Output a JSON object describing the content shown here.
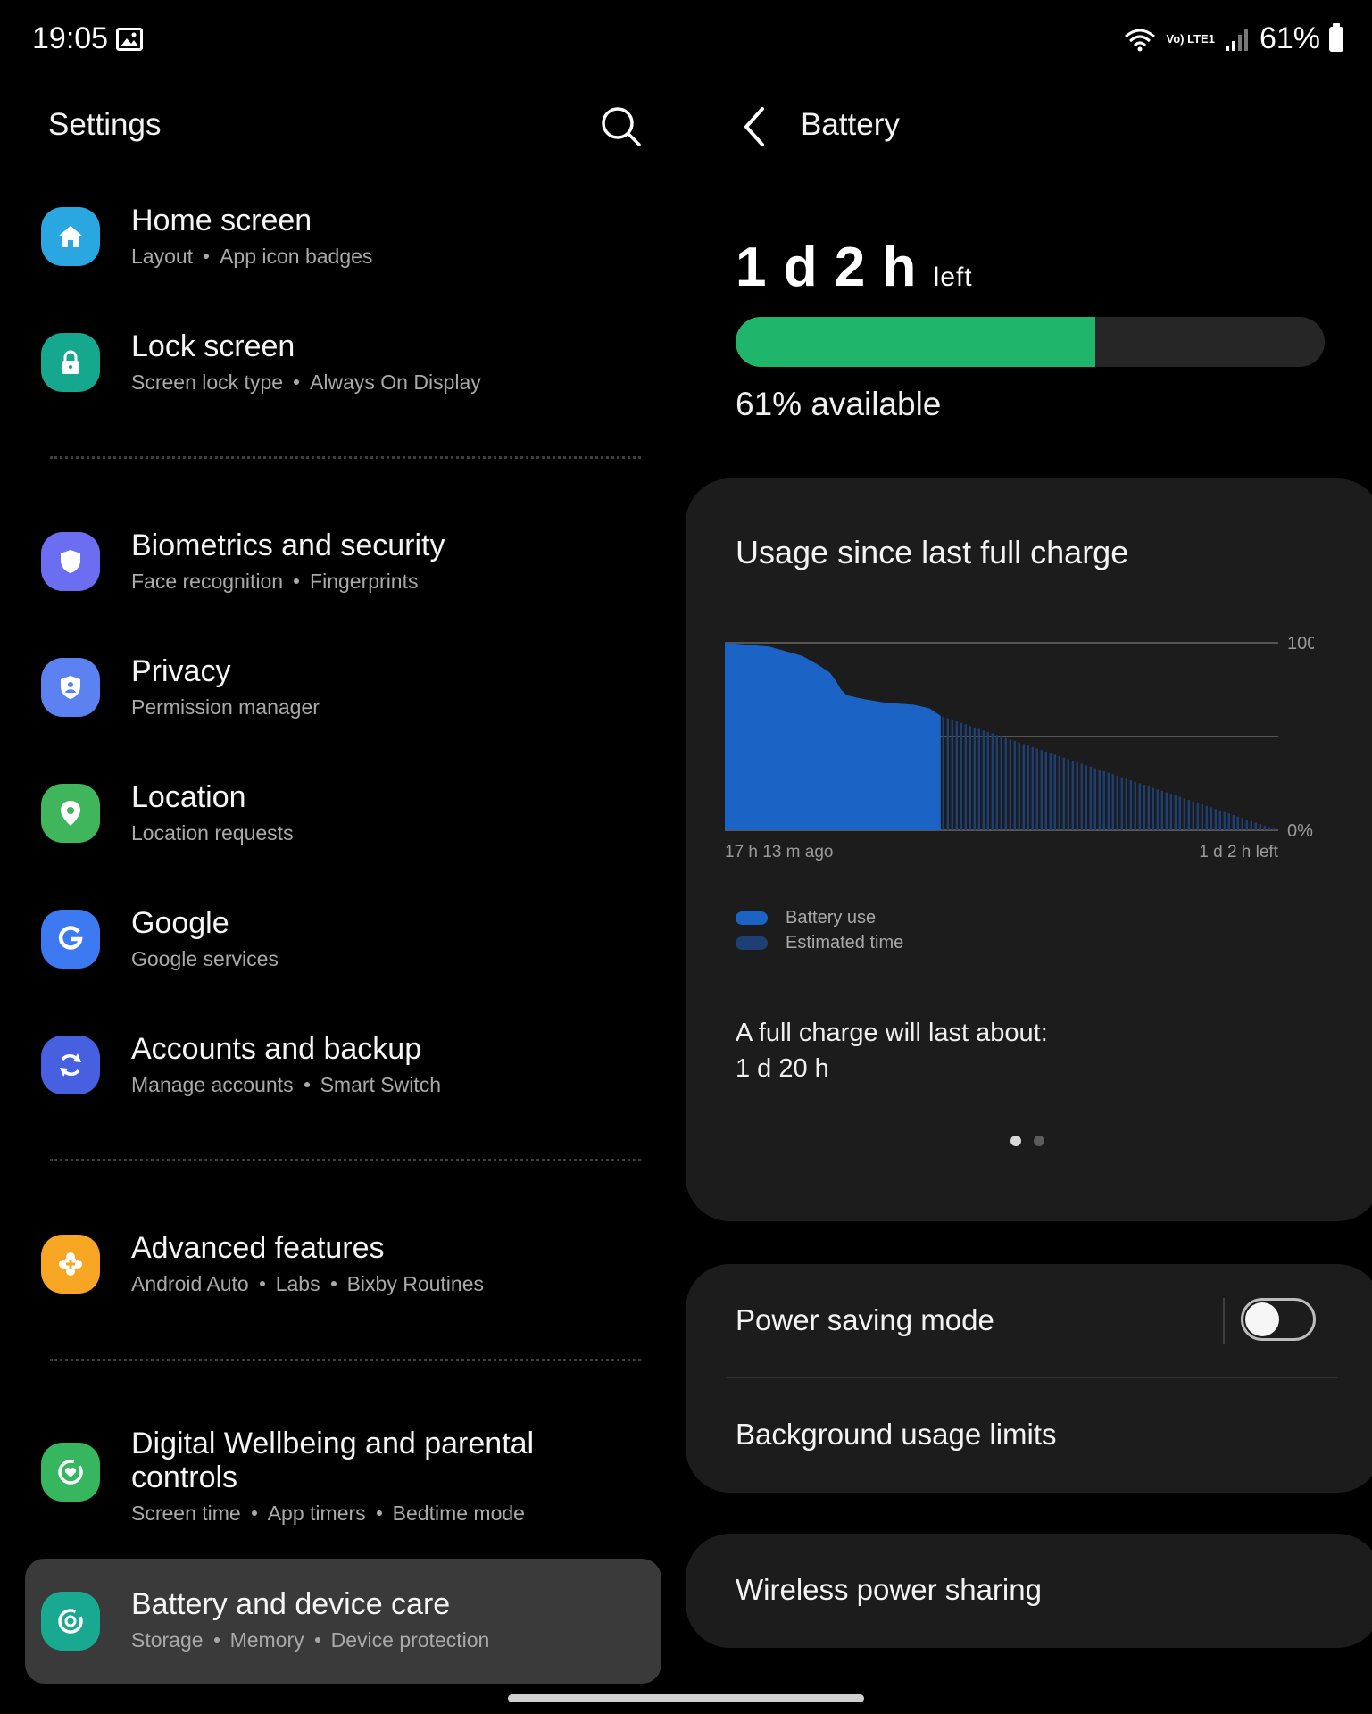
{
  "status_bar": {
    "time": "19:05",
    "network": "Vo) LTE1",
    "battery_percent": "61%",
    "icons": [
      "gallery-icon",
      "wifi-icon",
      "signal-icon",
      "battery-icon"
    ]
  },
  "settings": {
    "title": "Settings",
    "items": [
      {
        "title": "Home screen",
        "subtitle": [
          "Layout",
          "App icon badges"
        ],
        "icon": "home-icon",
        "color": "#2aa7e0"
      },
      {
        "title": "Lock screen",
        "subtitle": [
          "Screen lock type",
          "Always On Display"
        ],
        "icon": "lock-icon",
        "color": "#15a88e"
      },
      {
        "title": "Biometrics and security",
        "subtitle": [
          "Face recognition",
          "Fingerprints"
        ],
        "icon": "shield-icon",
        "color": "#6b6ef0"
      },
      {
        "title": "Privacy",
        "subtitle": [
          "Permission manager"
        ],
        "icon": "privacy-shield-icon",
        "color": "#5b82f0"
      },
      {
        "title": "Location",
        "subtitle": [
          "Location requests"
        ],
        "icon": "location-pin-icon",
        "color": "#3fb65b"
      },
      {
        "title": "Google",
        "subtitle": [
          "Google services"
        ],
        "icon": "google-g-icon",
        "color": "#3d79f0"
      },
      {
        "title": "Accounts and backup",
        "subtitle": [
          "Manage accounts",
          "Smart Switch"
        ],
        "icon": "sync-icon",
        "color": "#4660e0"
      },
      {
        "title": "Advanced features",
        "subtitle": [
          "Android Auto",
          "Labs",
          "Bixby Routines"
        ],
        "icon": "puzzle-icon",
        "color": "#f6a623"
      },
      {
        "title_line1": "Digital Wellbeing and parental",
        "title_line2": "controls",
        "subtitle": [
          "Screen time",
          "App timers",
          "Bedtime mode"
        ],
        "icon": "wellbeing-icon",
        "color": "#37b660"
      },
      {
        "title": "Battery and device care",
        "subtitle": [
          "Storage",
          "Memory",
          "Device protection"
        ],
        "icon": "device-care-icon",
        "color": "#19a991",
        "selected": true
      }
    ]
  },
  "battery": {
    "title": "Battery",
    "time_left": "1 d 2 h",
    "time_left_suffix": "left",
    "level_fraction": 0.61,
    "available_text": "61% available",
    "bar_color": "#1fb66c",
    "usage": {
      "title": "Usage since last full charge",
      "full_charge_label": "A full charge will last about:",
      "full_charge_value": "1 d 20 h",
      "pages": 2,
      "current_page": 1
    },
    "power_saving": {
      "label": "Power saving mode",
      "enabled": false
    },
    "background_limits_label": "Background usage limits",
    "wireless_sharing_label": "Wireless power sharing"
  },
  "chart_data": {
    "type": "area",
    "ylim": [
      0,
      100
    ],
    "y_tick_labels": [
      "100",
      "0%"
    ],
    "x_tick_labels": [
      "17 h 13 m ago",
      "1 d 2 h left"
    ],
    "legend": [
      "Battery use",
      "Estimated time"
    ],
    "series": [
      {
        "name": "Battery use",
        "color": "#1b64c6",
        "x_fraction": [
          0,
          0.08,
          0.14,
          0.17,
          0.19,
          0.2,
          0.21,
          0.22,
          0.25,
          0.29,
          0.34,
          0.37,
          0.39
        ],
        "values": [
          100,
          98,
          93,
          88,
          84,
          80,
          75,
          72,
          70,
          68,
          67,
          65,
          61
        ]
      },
      {
        "name": "Estimated time",
        "color": "#1e3f73",
        "x_fraction": [
          0.39,
          1.0
        ],
        "values": [
          61,
          0
        ]
      }
    ]
  }
}
